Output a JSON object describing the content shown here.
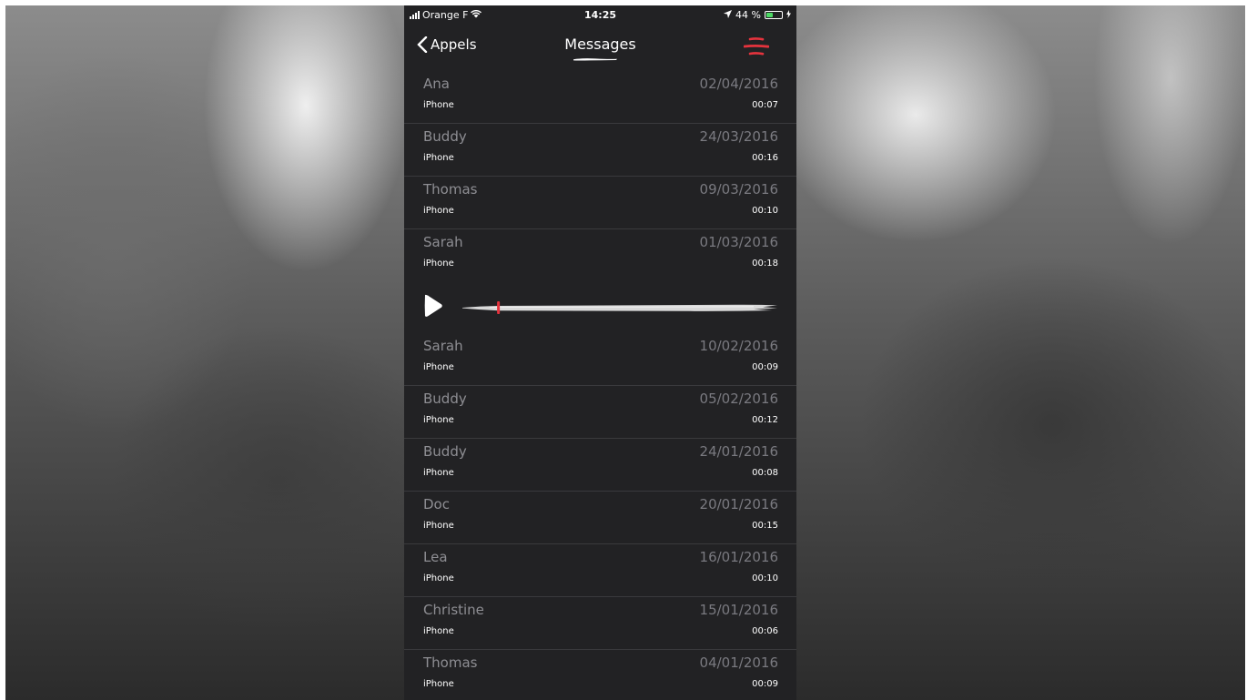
{
  "status_bar": {
    "carrier": "Orange F",
    "time": "14:25",
    "battery": "44 %"
  },
  "nav": {
    "back_label": "Appels",
    "title": "Messages"
  },
  "messages_before": [
    {
      "name": "Ana",
      "date": "02/04/2016",
      "source": "iPhone",
      "duration": "00:07"
    },
    {
      "name": "Buddy",
      "date": "24/03/2016",
      "source": "iPhone",
      "duration": "00:16"
    },
    {
      "name": "Thomas",
      "date": "09/03/2016",
      "source": "iPhone",
      "duration": "00:10"
    },
    {
      "name": "Sarah",
      "date": "01/03/2016",
      "source": "iPhone",
      "duration": "00:18"
    }
  ],
  "player": {
    "progress": 0.11
  },
  "messages_after": [
    {
      "name": "Sarah",
      "date": "10/02/2016",
      "source": "iPhone",
      "duration": "00:09"
    },
    {
      "name": "Buddy",
      "date": "05/02/2016",
      "source": "iPhone",
      "duration": "00:12"
    },
    {
      "name": "Buddy",
      "date": "24/01/2016",
      "source": "iPhone",
      "duration": "00:08"
    },
    {
      "name": "Doc",
      "date": "20/01/2016",
      "source": "iPhone",
      "duration": "00:15"
    },
    {
      "name": "Lea",
      "date": "16/01/2016",
      "source": "iPhone",
      "duration": "00:10"
    },
    {
      "name": "Christine",
      "date": "15/01/2016",
      "source": "iPhone",
      "duration": "00:06"
    },
    {
      "name": "Thomas",
      "date": "04/01/2016",
      "source": "iPhone",
      "duration": "00:09"
    }
  ],
  "colors": {
    "accent": "#e5333d",
    "background": "#222224",
    "separator": "#3a3a3d"
  }
}
